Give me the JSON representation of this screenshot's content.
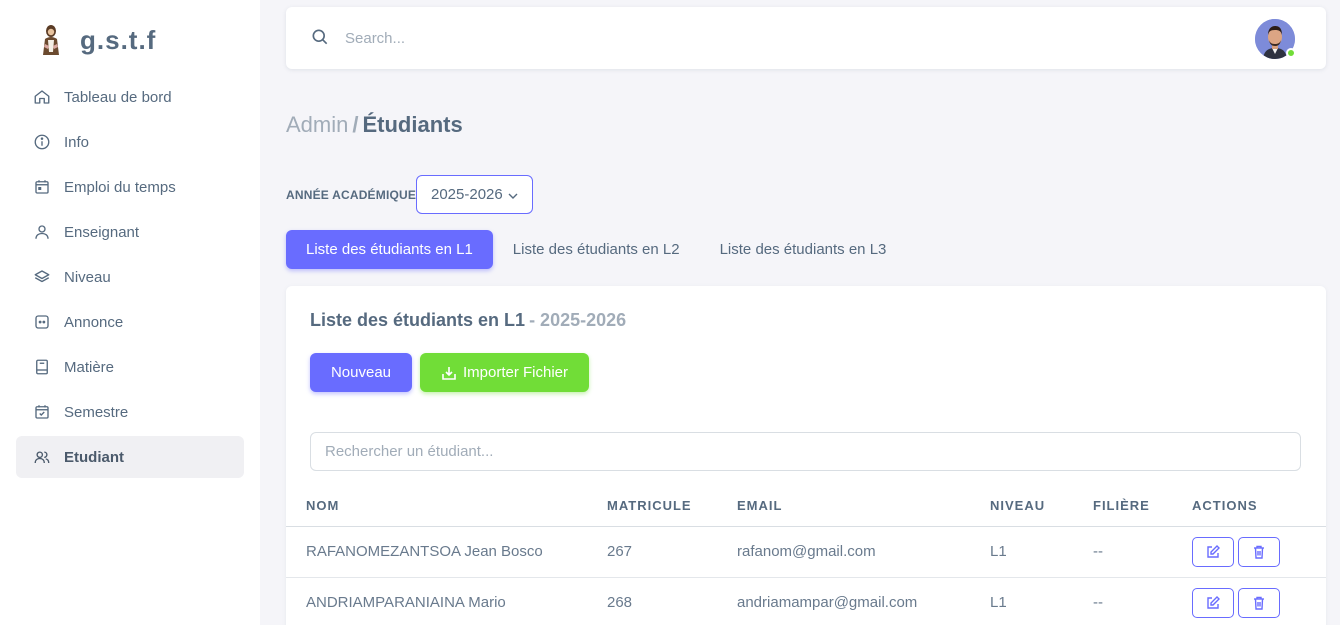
{
  "brand": {
    "name": "g.s.t.f",
    "logo": "saint-figure-logo"
  },
  "sidebar": {
    "items": [
      {
        "label": "Tableau de bord",
        "icon": "home-icon"
      },
      {
        "label": "Info",
        "icon": "info-icon"
      },
      {
        "label": "Emploi du temps",
        "icon": "calendar-icon"
      },
      {
        "label": "Enseignant",
        "icon": "user-icon"
      },
      {
        "label": "Niveau",
        "icon": "layers-icon"
      },
      {
        "label": "Annonce",
        "icon": "message-icon"
      },
      {
        "label": "Matière",
        "icon": "book-icon"
      },
      {
        "label": "Semestre",
        "icon": "calendar-check-icon"
      },
      {
        "label": "Etudiant",
        "icon": "users-icon",
        "active": true
      }
    ]
  },
  "navbar": {
    "search_placeholder": "Search...",
    "status": "online"
  },
  "breadcrumb": {
    "parent": "Admin",
    "separator": "/",
    "current": "Étudiants"
  },
  "academic_year": {
    "label": "ANNÉE ACADÉMIQUE:",
    "selected": "2025-2026"
  },
  "tabs": [
    {
      "label": "Liste des étudiants en L1",
      "active": true
    },
    {
      "label": "Liste des étudiants en L2"
    },
    {
      "label": "Liste des étudiants en L3"
    }
  ],
  "card": {
    "title": "Liste des étudiants en L1",
    "subtitle": "- 2025-2026",
    "new_button": "Nouveau",
    "import_button": "Importer Fichier",
    "search_placeholder": "Rechercher un étudiant..."
  },
  "table": {
    "columns": [
      "Nom",
      "Matricule",
      "Email",
      "Niveau",
      "Filière",
      "Actions"
    ],
    "rows": [
      {
        "nom": "RAFANOMEZANTSOA Jean Bosco",
        "matricule": "267",
        "email": "rafanom@gmail.com",
        "niveau": "L1",
        "filiere": "--"
      },
      {
        "nom": "ANDRIAMPARANIAINA Mario",
        "matricule": "268",
        "email": "andriamampar@gmail.com",
        "niveau": "L1",
        "filiere": "--"
      }
    ]
  },
  "colors": {
    "primary": "#696cff",
    "success": "#71dd37",
    "text": "#566a7f",
    "muted": "#a1acb8"
  }
}
